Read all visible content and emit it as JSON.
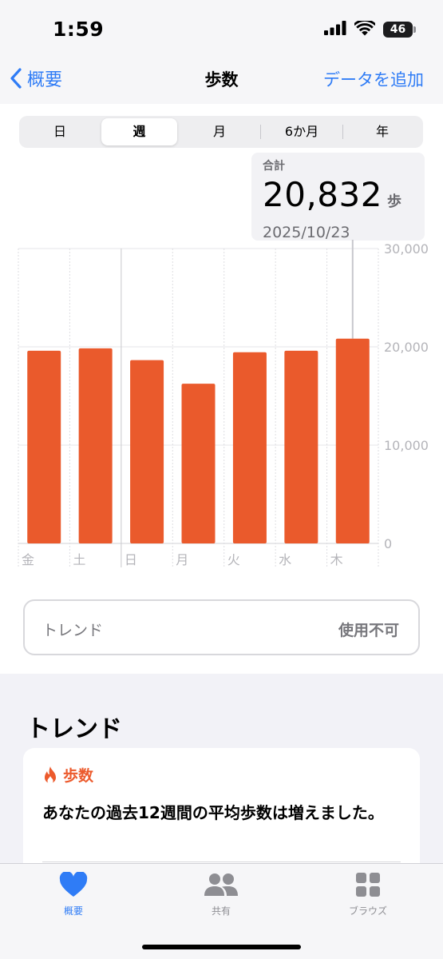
{
  "status": {
    "time": "1:59",
    "battery": "46"
  },
  "nav": {
    "back_label": "概要",
    "title": "歩数",
    "add_label": "データを追加"
  },
  "segments": [
    {
      "label": "日",
      "selected": false
    },
    {
      "label": "週",
      "selected": true
    },
    {
      "label": "月",
      "selected": false
    },
    {
      "label": "6か月",
      "selected": false
    },
    {
      "label": "年",
      "selected": false
    }
  ],
  "summary": {
    "label": "合計",
    "value": "20,832",
    "unit": "歩",
    "date": "2025/10/23"
  },
  "chart_data": {
    "type": "bar",
    "categories": [
      "金",
      "土",
      "日",
      "月",
      "火",
      "水",
      "木"
    ],
    "values": [
      19600,
      19850,
      18650,
      16250,
      19450,
      19600,
      20832
    ],
    "ylim": [
      0,
      30000
    ],
    "yticks": [
      "0",
      "10,000",
      "20,000",
      "30,000"
    ],
    "color": "#ea5a2c",
    "highlight_index": 6,
    "grid": true
  },
  "trend_row": {
    "label": "トレンド",
    "value": "使用不可"
  },
  "trends_section": {
    "title": "トレンド",
    "card": {
      "category": "歩数",
      "text": "あなたの過去12週間の平均歩数は増えました。",
      "accent": "#ec5a2c"
    }
  },
  "tabbar": {
    "tabs": [
      {
        "label": "概要",
        "icon": "heart-icon",
        "active": true
      },
      {
        "label": "共有",
        "icon": "people-icon",
        "active": false
      },
      {
        "label": "ブラウズ",
        "icon": "grid-icon",
        "active": false
      }
    ],
    "active_color": "#2f7cf6",
    "inactive_color": "#8e8e93"
  }
}
